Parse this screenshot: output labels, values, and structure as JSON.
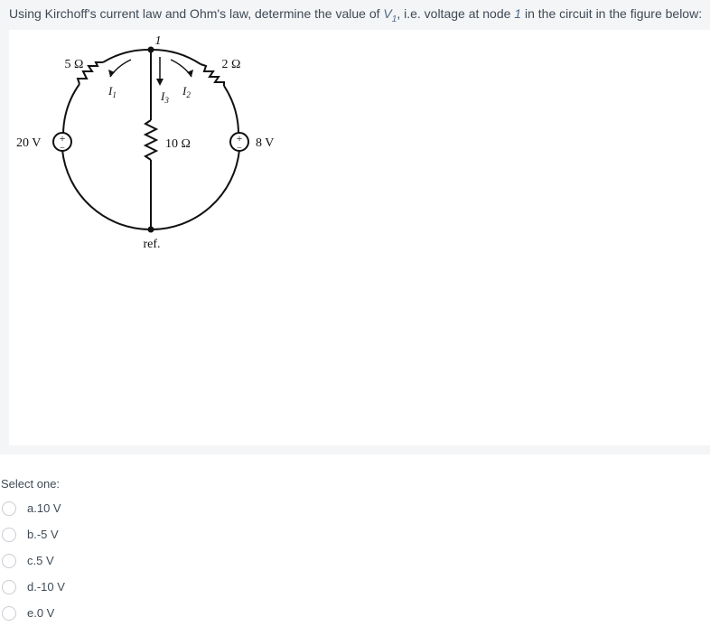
{
  "question": {
    "text_before": "Using Kirchoff's current law and Ohm's law, determine the value of ",
    "var_symbol": "V",
    "var_sub": "1",
    "text_middle": ", i.e. voltage at node ",
    "node": "1",
    "text_after": " in the circuit in the figure below:"
  },
  "circuit": {
    "node_label": "1",
    "r_left": "5 Ω",
    "r_right": "2 Ω",
    "r_middle": "10 Ω",
    "source_left": "20 V",
    "source_right": "8 V",
    "plus": "+",
    "minus": "−",
    "i1": "I",
    "i1_sub": "1",
    "i2": "I",
    "i2_sub": "2",
    "i3": "I",
    "i3_sub": "3",
    "ref": "ref."
  },
  "answer": {
    "prompt": "Select one:",
    "options": [
      {
        "label": "a.10 V"
      },
      {
        "label": "b.-5 V"
      },
      {
        "label": "c.5 V"
      },
      {
        "label": "d.-10 V"
      },
      {
        "label": "e.0 V"
      }
    ]
  }
}
